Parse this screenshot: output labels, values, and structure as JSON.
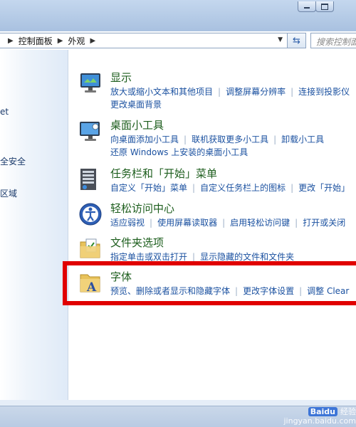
{
  "address": {
    "crumbs": [
      "控制面板",
      "外观"
    ]
  },
  "search": {
    "placeholder": "搜索控制面"
  },
  "nav": {
    "items": [
      "et",
      "全安全",
      "区域"
    ]
  },
  "categories": [
    {
      "title": "显示",
      "links": [
        [
          "放大或缩小文本和其他项目",
          "调整屏幕分辨率",
          "连接到投影仪"
        ],
        [
          "更改桌面背景"
        ]
      ]
    },
    {
      "title": "桌面小工具",
      "links": [
        [
          "向桌面添加小工具",
          "联机获取更多小工具",
          "卸载小工具"
        ],
        [
          "还原 Windows 上安装的桌面小工具"
        ]
      ]
    },
    {
      "title": "任务栏和「开始」菜单",
      "links": [
        [
          "自定义「开始」菜单",
          "自定义任务栏上的图标",
          "更改「开始」"
        ]
      ]
    },
    {
      "title": "轻松访问中心",
      "links": [
        [
          "适应弱视",
          "使用屏幕读取器",
          "启用轻松访问键",
          "打开或关闭"
        ]
      ]
    },
    {
      "title": "文件夹选项",
      "links": [
        [
          "指定单击或双击打开",
          "显示隐藏的文件和文件夹"
        ]
      ]
    },
    {
      "title": "字体",
      "links": [
        [
          "预览、删除或者显示和隐藏字体",
          "更改字体设置",
          "调整 Clear"
        ]
      ]
    }
  ],
  "watermark": {
    "logo": "Baidu",
    "line1": "经验",
    "line2": "jingyan.baidu.com"
  }
}
